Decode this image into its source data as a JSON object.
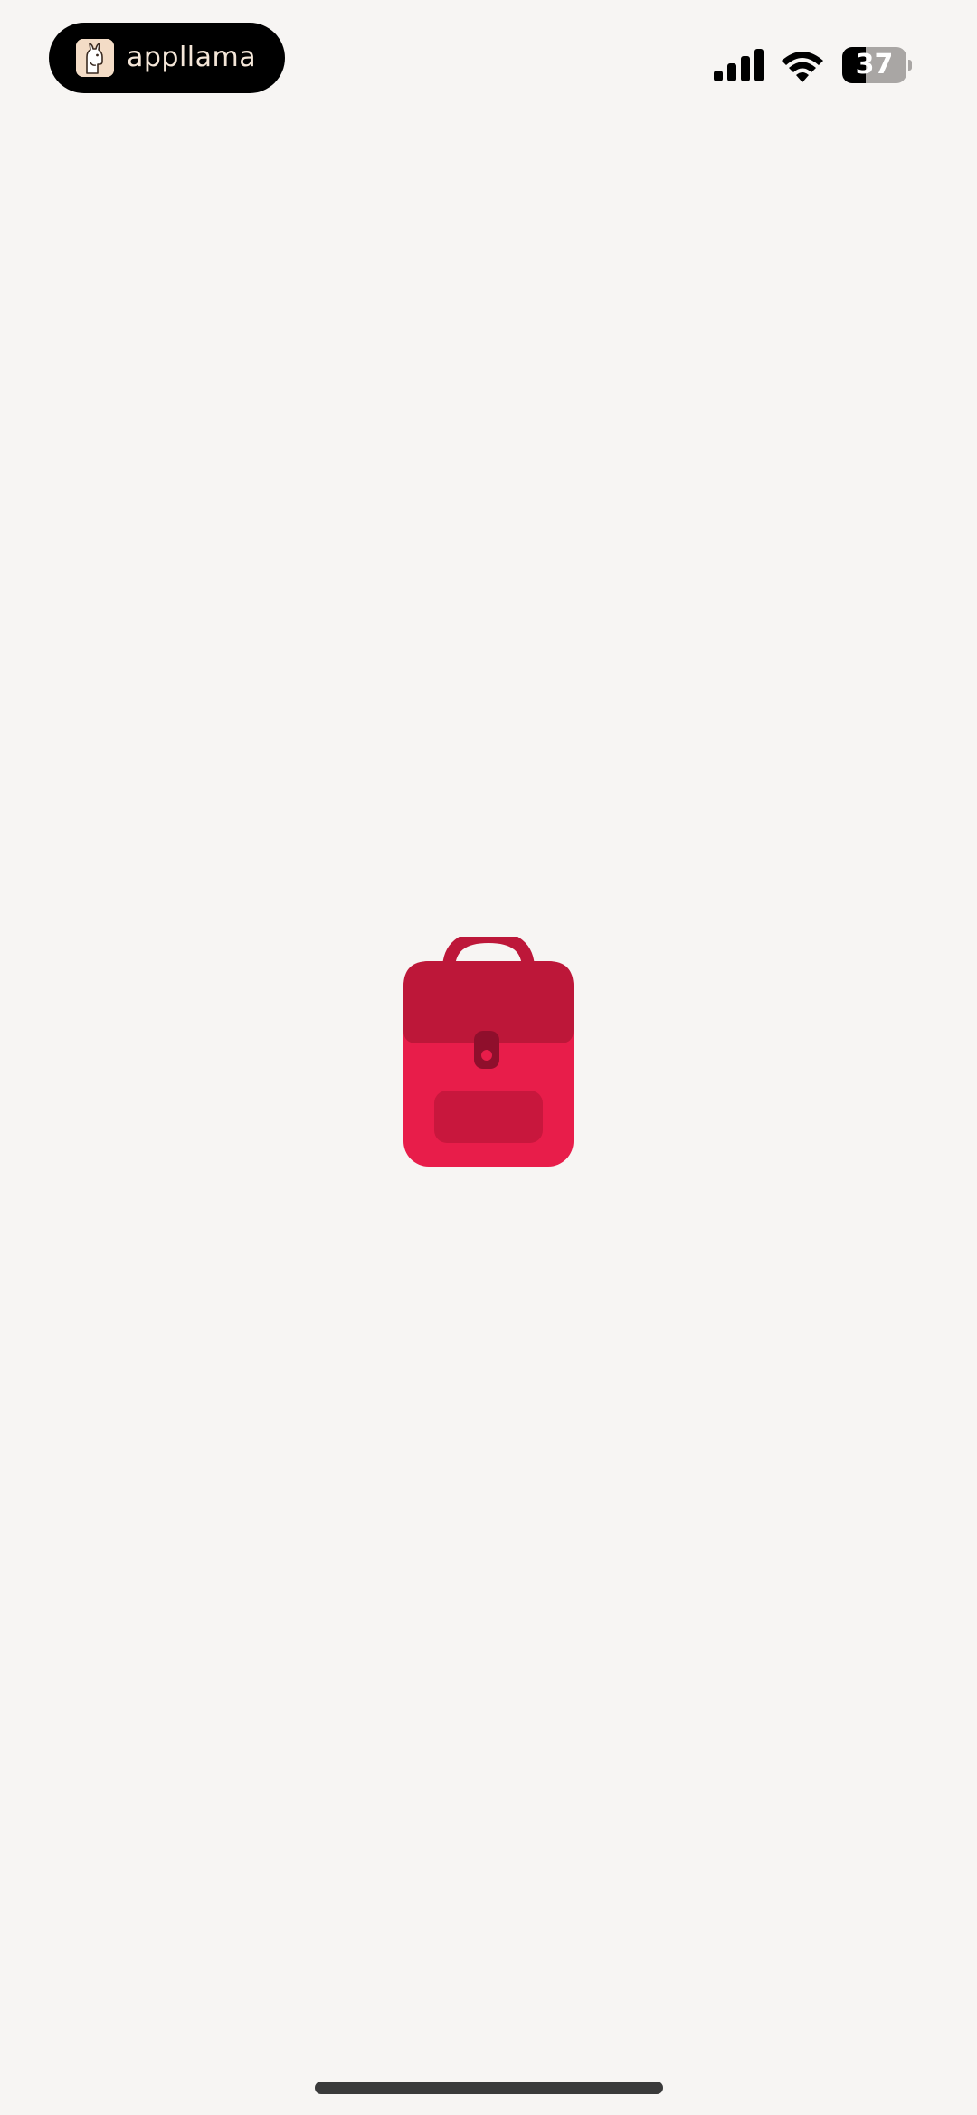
{
  "status_bar": {
    "app_name": "appllama",
    "battery_percent": 37,
    "battery_label": "37",
    "icons": [
      "llama-logo-icon",
      "signal-icon",
      "wifi-icon",
      "battery-icon"
    ]
  },
  "splash": {
    "icon": "backpack-icon",
    "colors": {
      "background": "#f7f5f3",
      "backpack_body": "#e81d4a",
      "backpack_flap": "#bd1739",
      "backpack_strap": "#8f0f2c"
    }
  }
}
